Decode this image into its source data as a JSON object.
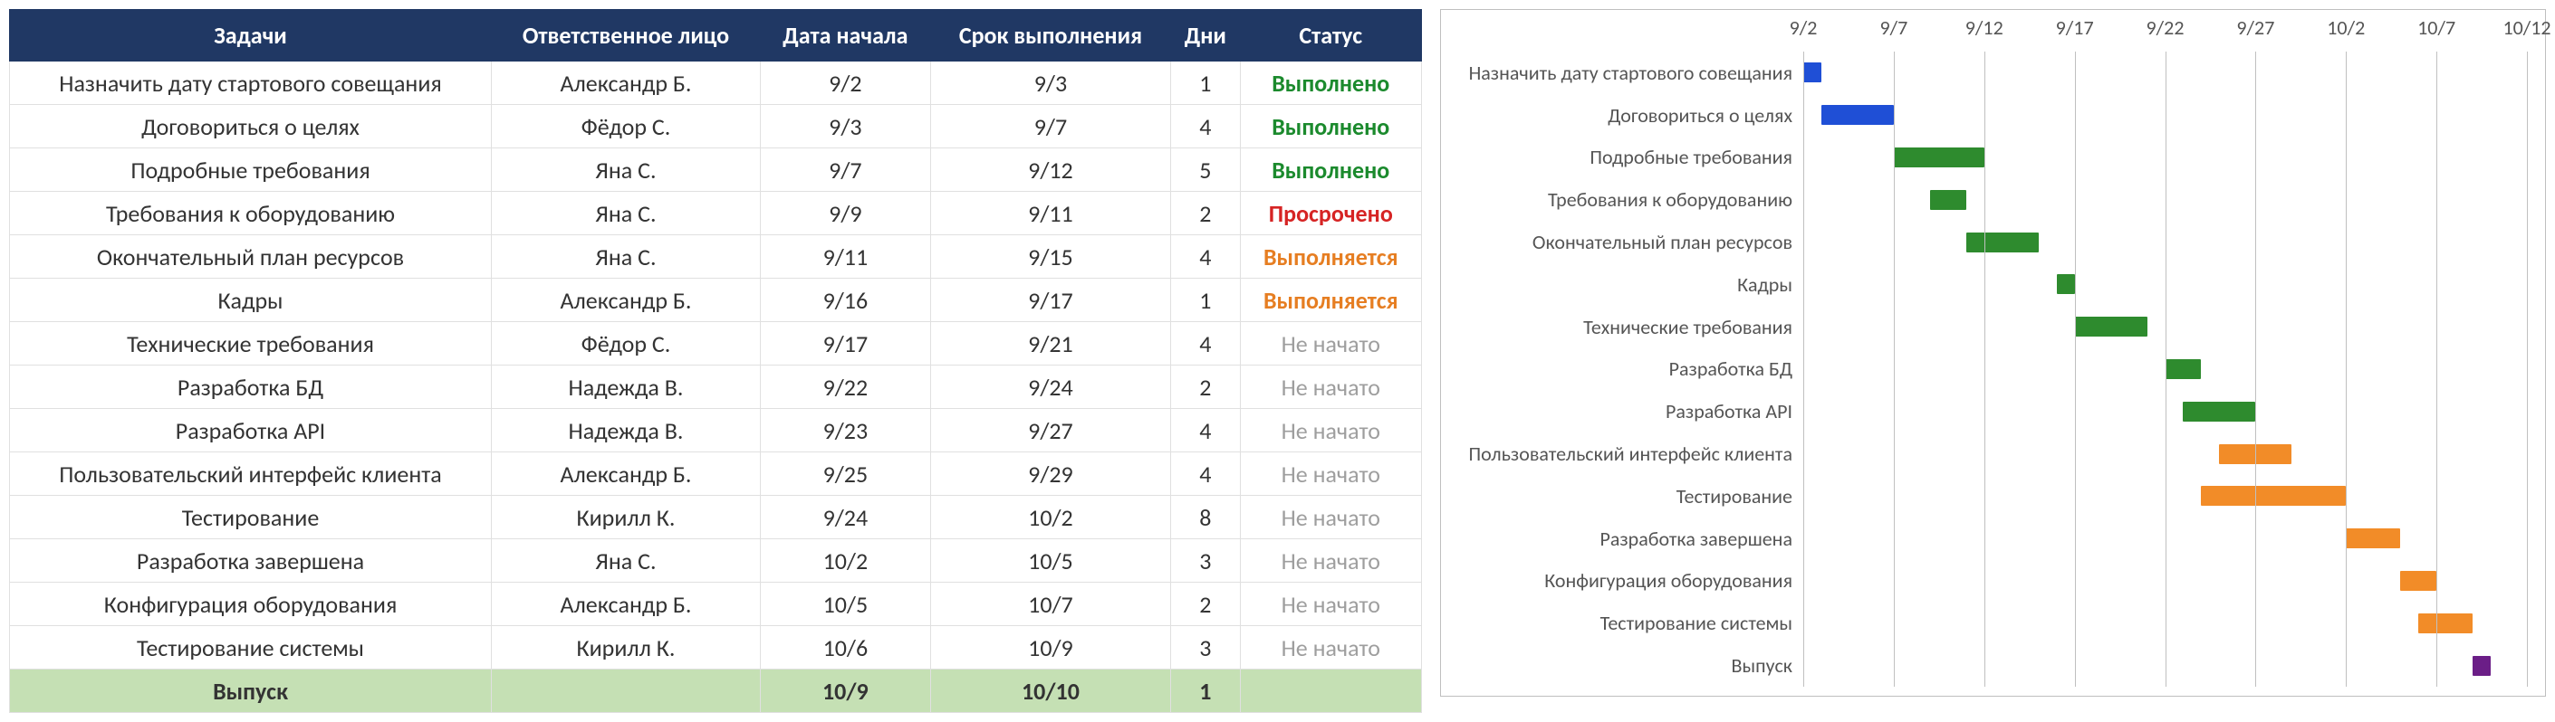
{
  "columns": {
    "task": "Задачи",
    "owner": "Ответственное лицо",
    "start": "Дата начала",
    "end": "Срок выполнения",
    "days": "Дни",
    "status": "Статус"
  },
  "status_labels": {
    "done": "Выполнено",
    "overdue": "Просрочено",
    "progress": "Выполняется",
    "notstarted": "Не начато"
  },
  "tasks": [
    {
      "name": "Назначить дату стартового совещания",
      "owner": "Александр Б.",
      "start": "9/2",
      "end": "9/3",
      "days": 1,
      "status": "done",
      "bar_color": "blue"
    },
    {
      "name": "Договориться о целях",
      "owner": "Фёдор С.",
      "start": "9/3",
      "end": "9/7",
      "days": 4,
      "status": "done",
      "bar_color": "blue"
    },
    {
      "name": "Подробные требования",
      "owner": "Яна С.",
      "start": "9/7",
      "end": "9/12",
      "days": 5,
      "status": "done",
      "bar_color": "green"
    },
    {
      "name": "Требования к оборудованию",
      "owner": "Яна С.",
      "start": "9/9",
      "end": "9/11",
      "days": 2,
      "status": "overdue",
      "bar_color": "green"
    },
    {
      "name": "Окончательный план ресурсов",
      "owner": "Яна С.",
      "start": "9/11",
      "end": "9/15",
      "days": 4,
      "status": "progress",
      "bar_color": "green"
    },
    {
      "name": "Кадры",
      "owner": "Александр Б.",
      "start": "9/16",
      "end": "9/17",
      "days": 1,
      "status": "progress",
      "bar_color": "green"
    },
    {
      "name": "Технические требования",
      "owner": "Фёдор С.",
      "start": "9/17",
      "end": "9/21",
      "days": 4,
      "status": "notstarted",
      "bar_color": "green"
    },
    {
      "name": "Разработка БД",
      "owner": "Надежда В.",
      "start": "9/22",
      "end": "9/24",
      "days": 2,
      "status": "notstarted",
      "bar_color": "green"
    },
    {
      "name": "Разработка API",
      "owner": "Надежда В.",
      "start": "9/23",
      "end": "9/27",
      "days": 4,
      "status": "notstarted",
      "bar_color": "green"
    },
    {
      "name": "Пользовательский интерфейс клиента",
      "owner": "Александр Б.",
      "start": "9/25",
      "end": "9/29",
      "days": 4,
      "status": "notstarted",
      "bar_color": "orange"
    },
    {
      "name": "Тестирование",
      "owner": "Кирилл К.",
      "start": "9/24",
      "end": "10/2",
      "days": 8,
      "status": "notstarted",
      "bar_color": "orange"
    },
    {
      "name": "Разработка завершена",
      "owner": "Яна С.",
      "start": "10/2",
      "end": "10/5",
      "days": 3,
      "status": "notstarted",
      "bar_color": "orange"
    },
    {
      "name": "Конфигурация оборудования",
      "owner": "Александр Б.",
      "start": "10/5",
      "end": "10/7",
      "days": 2,
      "status": "notstarted",
      "bar_color": "orange"
    },
    {
      "name": "Тестирование системы",
      "owner": "Кирилл К.",
      "start": "10/6",
      "end": "10/9",
      "days": 3,
      "status": "notstarted",
      "bar_color": "orange"
    },
    {
      "name": "Выпуск",
      "owner": "",
      "start": "10/9",
      "end": "10/10",
      "days": 1,
      "status": "",
      "bar_color": "purple",
      "milestone": true
    }
  ],
  "chart_data": {
    "type": "bar",
    "orientation": "horizontal-gantt",
    "title": "",
    "xlabel": "",
    "ylabel": "",
    "x_ticks": [
      "9/2",
      "9/7",
      "9/12",
      "9/17",
      "9/22",
      "9/27",
      "10/2",
      "10/7",
      "10/12"
    ],
    "x_range_serial": {
      "min": 1,
      "max": 41
    },
    "series_comment": "x is day index counting 9/1 = 0; each bar spans [start_serial, start_serial+days]",
    "series": [
      {
        "name": "Назначить дату стартового совещания",
        "start_serial": 1,
        "days": 1,
        "color": "blue"
      },
      {
        "name": "Договориться о целях",
        "start_serial": 2,
        "days": 4,
        "color": "blue"
      },
      {
        "name": "Подробные требования",
        "start_serial": 6,
        "days": 5,
        "color": "green"
      },
      {
        "name": "Требования к оборудованию",
        "start_serial": 8,
        "days": 2,
        "color": "green"
      },
      {
        "name": "Окончательный план ресурсов",
        "start_serial": 10,
        "days": 4,
        "color": "green"
      },
      {
        "name": "Кадры",
        "start_serial": 15,
        "days": 1,
        "color": "green"
      },
      {
        "name": "Технические требования",
        "start_serial": 16,
        "days": 4,
        "color": "green"
      },
      {
        "name": "Разработка БД",
        "start_serial": 21,
        "days": 2,
        "color": "green"
      },
      {
        "name": "Разработка API",
        "start_serial": 22,
        "days": 4,
        "color": "green"
      },
      {
        "name": "Пользовательский интерфейс клиента",
        "start_serial": 24,
        "days": 4,
        "color": "orange"
      },
      {
        "name": "Тестирование",
        "start_serial": 23,
        "days": 8,
        "color": "orange"
      },
      {
        "name": "Разработка завершена",
        "start_serial": 31,
        "days": 3,
        "color": "orange"
      },
      {
        "name": "Конфигурация оборудования",
        "start_serial": 34,
        "days": 2,
        "color": "orange"
      },
      {
        "name": "Тестирование системы",
        "start_serial": 35,
        "days": 3,
        "color": "orange"
      },
      {
        "name": "Выпуск",
        "start_serial": 38,
        "days": 1,
        "color": "purple"
      }
    ],
    "legend": null,
    "grid": {
      "vertical": true,
      "horizontal": false
    }
  }
}
